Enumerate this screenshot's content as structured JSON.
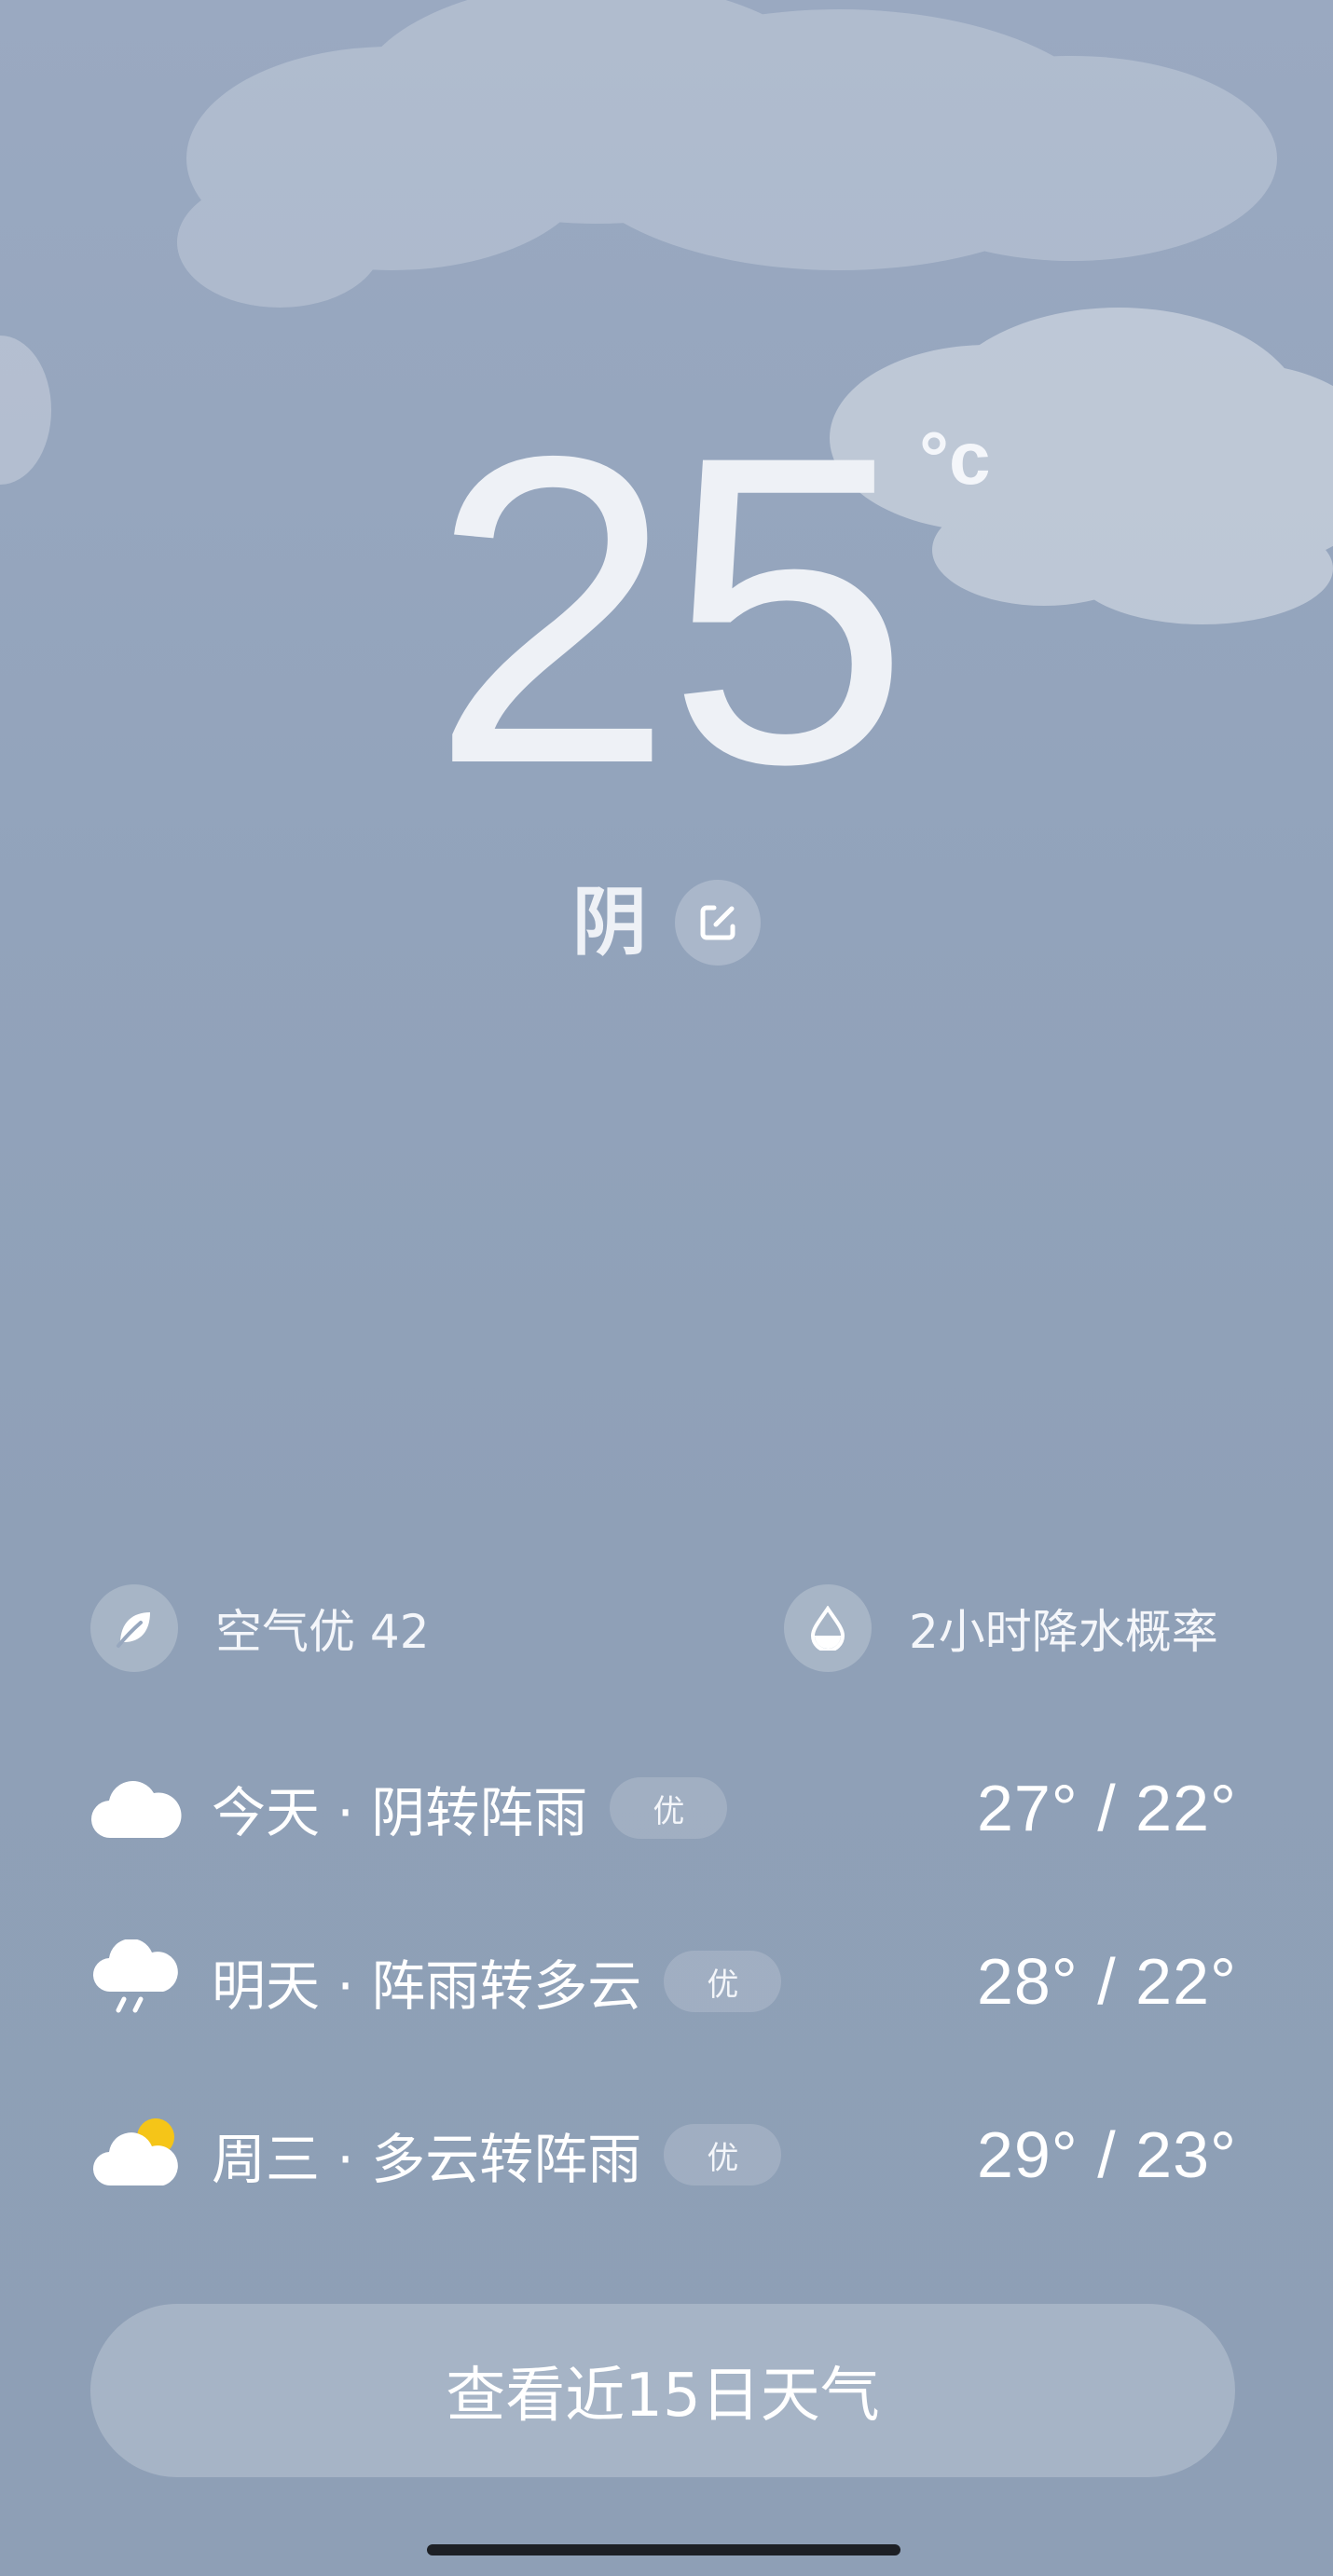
{
  "current": {
    "temperature": "25",
    "unit": "°c",
    "condition": "阴"
  },
  "metrics": {
    "air_quality": {
      "label": "空气优 42",
      "icon": "leaf-icon"
    },
    "precipitation": {
      "label": "2小时降水概率",
      "icon": "water-drop-icon"
    }
  },
  "forecast": [
    {
      "icon": "cloudy-icon",
      "text": "今天 · 阴转阵雨",
      "aq": "优",
      "temps": "27° / 22°"
    },
    {
      "icon": "rain-cloud-icon",
      "text": "明天 · 阵雨转多云",
      "aq": "优",
      "temps": "28° / 22°"
    },
    {
      "icon": "partly-cloudy-icon",
      "text": "周三 · 多云转阵雨",
      "aq": "优",
      "temps": "29° / 23°"
    }
  ],
  "forecast_button": {
    "label": "查看近15日天气"
  },
  "colors": {
    "background": "#92a3bb",
    "sun": "#f5c518"
  }
}
